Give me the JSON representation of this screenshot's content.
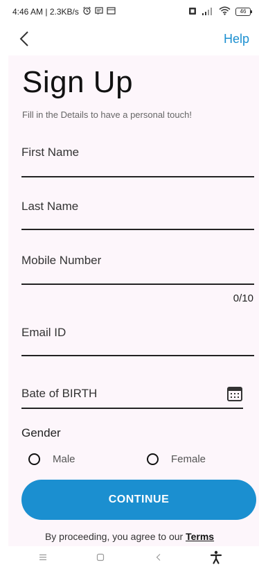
{
  "status_bar": {
    "time_speed": "4:46 AM | 2.3KB/s",
    "battery": "46"
  },
  "nav": {
    "help_label": "Help"
  },
  "form": {
    "title": "Sign Up",
    "subtitle": "Fill in the Details to have a personal touch!",
    "first_name_label": "First Name",
    "last_name_label": "Last Name",
    "mobile_label": "Mobile Number",
    "mobile_counter": "0/10",
    "email_label": "Email ID",
    "dob_label": "Bate of BIRTH",
    "gender_label": "Gender",
    "gender_options": [
      "Male",
      "Female"
    ],
    "continue_label": "CONTINUE",
    "agree_text": "By proceeding, you agree to our",
    "terms_label": "Terms"
  },
  "colors": {
    "accent": "#1b8fd0",
    "card_bg": "#fdf6fb"
  },
  "icons": {
    "back": "chevron-left-icon",
    "calendar": "calendar-icon",
    "nav_home": "home-icon",
    "nav_menu": "menu-icon",
    "nav_back": "back-icon",
    "accessibility": "accessibility-icon"
  }
}
